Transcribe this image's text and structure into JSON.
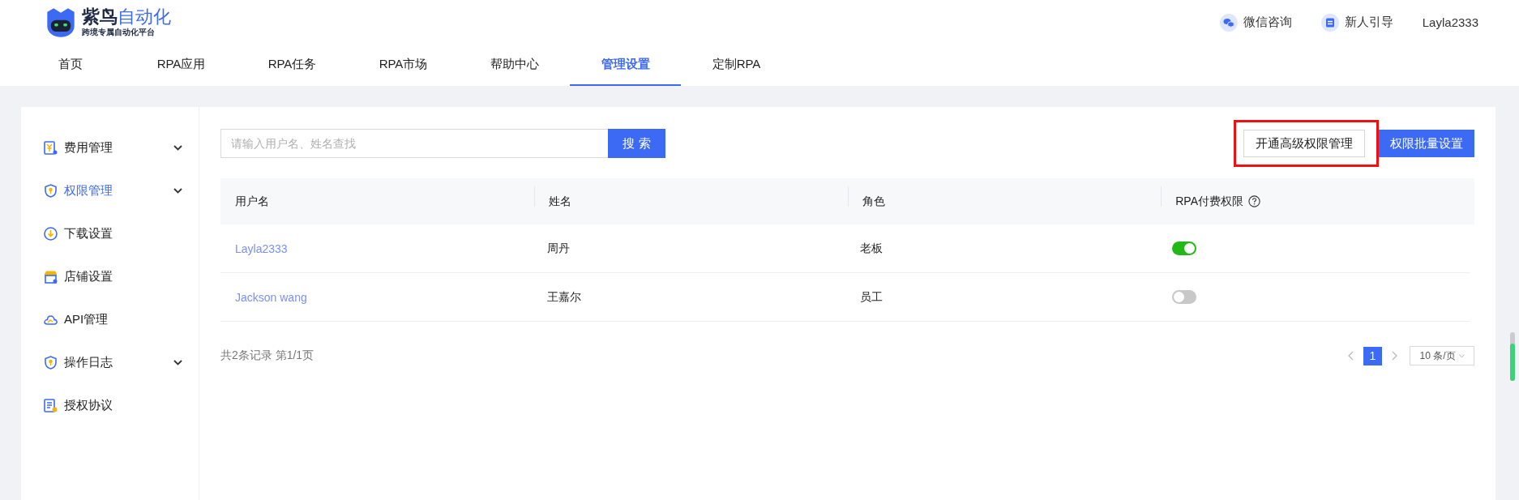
{
  "logo": {
    "brand": "紫鸟",
    "brand_accent": "自动化",
    "tagline": "跨境专属自动化平台"
  },
  "header_links": [
    {
      "kind": "wechat",
      "label": "微信咨询"
    },
    {
      "kind": "guide",
      "label": "新人引导"
    }
  ],
  "user": "Layla2333",
  "nav": [
    {
      "label": "首页",
      "selected": false
    },
    {
      "label": "RPA应用",
      "selected": false
    },
    {
      "label": "RPA任务",
      "selected": false
    },
    {
      "label": "RPA市场",
      "selected": false
    },
    {
      "label": "帮助中心",
      "selected": false
    },
    {
      "label": "管理设置",
      "selected": true
    },
    {
      "label": "定制RPA",
      "selected": false
    }
  ],
  "sidebar": {
    "items": [
      {
        "kind": "bill",
        "label": "费用管理",
        "expandable": true,
        "selected": false
      },
      {
        "kind": "shield",
        "label": "权限管理",
        "expandable": true,
        "selected": true
      },
      {
        "kind": "download",
        "label": "下载设置",
        "expandable": false,
        "selected": false
      },
      {
        "kind": "store",
        "label": "店铺设置",
        "expandable": false,
        "selected": false
      },
      {
        "kind": "cloud",
        "label": "API管理",
        "expandable": false,
        "selected": false
      },
      {
        "kind": "shield",
        "label": "操作日志",
        "expandable": true,
        "selected": false
      },
      {
        "kind": "document",
        "label": "授权协议",
        "expandable": false,
        "selected": false
      }
    ]
  },
  "search": {
    "placeholder": "请输入用户名、姓名查找",
    "button": "搜 索"
  },
  "actions": [
    {
      "kind": "outline",
      "label": "开通高级权限管理",
      "highlighted": true
    },
    {
      "kind": "primary",
      "label": "权限批量设置",
      "highlighted": false
    }
  ],
  "table": {
    "columns": [
      {
        "label": "用户名",
        "help": false
      },
      {
        "label": "姓名",
        "help": false
      },
      {
        "label": "角色",
        "help": false
      },
      {
        "label": "RPA付费权限",
        "help": true
      }
    ],
    "rows": [
      {
        "username": "Layla2333",
        "name": "周丹",
        "role": "老板",
        "rpa_paid": true
      },
      {
        "username": "Jackson wang",
        "name": "王嘉尔",
        "role": "员工",
        "rpa_paid": false
      }
    ]
  },
  "footer": {
    "summary": "共2条记录 第1/1页",
    "pages": [
      {
        "label": "1",
        "selected": true
      }
    ],
    "page_size": "10 条/页"
  }
}
